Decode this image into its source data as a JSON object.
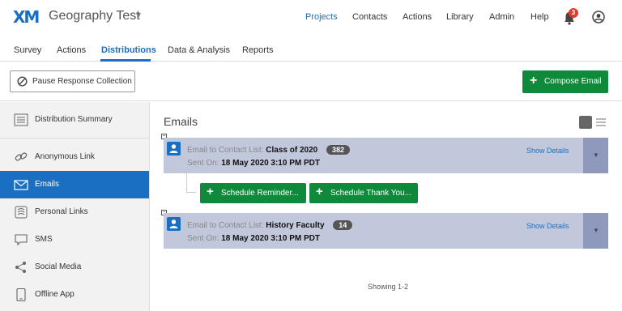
{
  "header": {
    "logo": "XM",
    "project_title": "Geography Test",
    "nav": [
      {
        "label": "Projects"
      },
      {
        "label": "Contacts"
      },
      {
        "label": "Actions"
      },
      {
        "label": "Library"
      },
      {
        "label": "Admin"
      },
      {
        "label": "Help"
      }
    ],
    "notification_count": "3",
    "active_color": "#1b6fc2"
  },
  "subnav": {
    "tabs": [
      {
        "label": "Survey"
      },
      {
        "label": "Actions"
      },
      {
        "label": "Distributions"
      },
      {
        "label": "Data & Analysis"
      },
      {
        "label": "Reports"
      }
    ],
    "active": "Distributions"
  },
  "toolbar": {
    "pause_label": "Pause Response Collection",
    "compose_label": "Compose Email",
    "compose_color": "#0f8a3b"
  },
  "sidebar": {
    "items": [
      {
        "label": "Distribution Summary",
        "icon": "list-icon"
      },
      {
        "label": "Anonymous Link",
        "icon": "link-icon"
      },
      {
        "label": "Emails",
        "icon": "envelope-icon"
      },
      {
        "label": "Personal Links",
        "icon": "fingerprint-icon"
      },
      {
        "label": "SMS",
        "icon": "chat-bubble-icon"
      },
      {
        "label": "Social Media",
        "icon": "share-icon"
      },
      {
        "label": "Offline App",
        "icon": "tablet-icon"
      }
    ],
    "active": "Emails"
  },
  "main": {
    "title": "Emails",
    "emails": [
      {
        "prefix": "Email to Contact List:",
        "list_name": "Class of 2020",
        "count": "382",
        "sent_prefix": "Sent On:",
        "sent_on": "18 May 2020 3:10 PM PDT",
        "show_details": "Show Details"
      },
      {
        "prefix": "Email to Contact List:",
        "list_name": "History Faculty",
        "count": "14",
        "sent_prefix": "Sent On:",
        "sent_on": "18 May 2020 3:10 PM PDT",
        "show_details": "Show Details"
      }
    ],
    "followups": [
      {
        "label": "Schedule Reminder..."
      },
      {
        "label": "Schedule Thank You..."
      }
    ],
    "showing": "Showing 1-2"
  }
}
